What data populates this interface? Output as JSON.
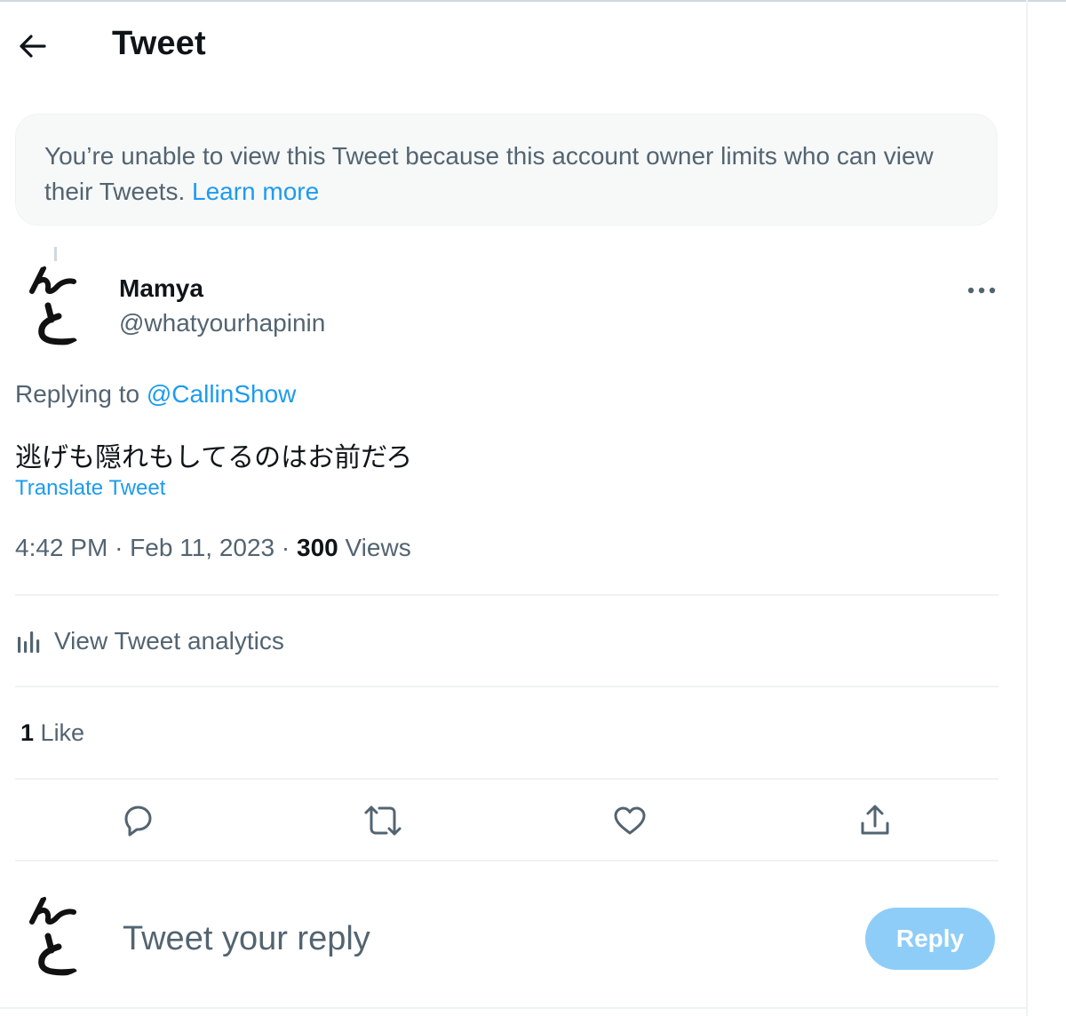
{
  "header": {
    "title": "Tweet",
    "back_icon": "arrow-left-icon"
  },
  "notice": {
    "text": "You’re unable to view this Tweet because this account owner limits who can view their Tweets.",
    "link_label": "Learn more",
    "link_color": "#1d9bf0"
  },
  "author": {
    "name": "Mamya",
    "handle": "@whatyourhapinin",
    "avatar_text": "んと",
    "more_icon": "more-horizontal-icon"
  },
  "tweet": {
    "replying_prefix": "Replying to",
    "replying_to": "@CallinShow",
    "text": "逃げも隠れもしてるのはお前だろ",
    "translate_label": "Translate Tweet",
    "time": "4:42 PM",
    "date": "Feb 11, 2023",
    "views_count": "300",
    "views_label": "Views"
  },
  "analytics": {
    "label": "View Tweet analytics",
    "icon": "bar-chart-icon"
  },
  "stats": {
    "likes_count": "1",
    "likes_label": "Like"
  },
  "actions": [
    {
      "name": "reply",
      "icon": "reply-bubble-icon"
    },
    {
      "name": "retweet",
      "icon": "retweet-icon"
    },
    {
      "name": "like",
      "icon": "heart-icon"
    },
    {
      "name": "share",
      "icon": "share-upload-icon"
    }
  ],
  "reply_box": {
    "placeholder": "Tweet your reply",
    "button_label": "Reply",
    "button_color": "#8ecdf8"
  },
  "colors": {
    "accent": "#1d9bf0",
    "text_primary": "#0f1419",
    "text_secondary": "#536471",
    "divider": "#eff3f4"
  }
}
